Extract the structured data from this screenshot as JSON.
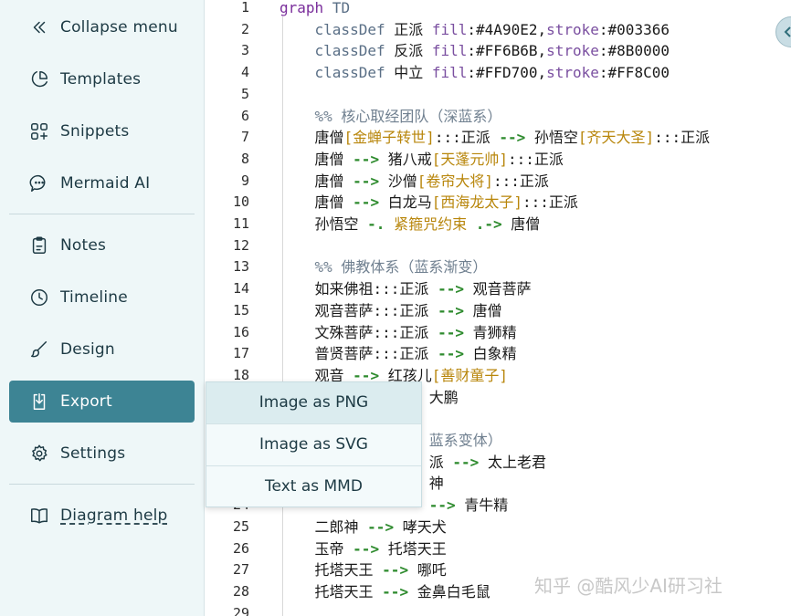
{
  "sidebar": {
    "collapse_label": "Collapse menu",
    "templates_label": "Templates",
    "snippets_label": "Snippets",
    "mermaid_ai_label": "Mermaid AI",
    "notes_label": "Notes",
    "timeline_label": "Timeline",
    "design_label": "Design",
    "export_label": "Export",
    "settings_label": "Settings",
    "help_label": "Diagram help"
  },
  "export_menu": {
    "png_label": "Image as PNG",
    "svg_label": "Image as SVG",
    "mmd_label": "Text as MMD"
  },
  "editor": {
    "line_numbers": [
      "1",
      "2",
      "3",
      "4",
      "5",
      "6",
      "7",
      "8",
      "9",
      "10",
      "11",
      "12",
      "13",
      "14",
      "15",
      "16",
      "17",
      "18",
      "19",
      "20",
      "21",
      "22",
      "23",
      "24",
      "25",
      "26",
      "27",
      "28",
      "29"
    ],
    "lines": [
      [
        {
          "t": "graph",
          "c": "kw"
        },
        {
          "t": " TD",
          "c": "kw2"
        }
      ],
      [
        {
          "t": "    classDef",
          "c": "kw2"
        },
        {
          "t": " 正派 ",
          "c": ""
        },
        {
          "t": "fill",
          "c": "fill"
        },
        {
          "t": ":#4A90E2,",
          "c": ""
        },
        {
          "t": "stroke",
          "c": "fill"
        },
        {
          "t": ":#003366",
          "c": ""
        }
      ],
      [
        {
          "t": "    classDef",
          "c": "kw2"
        },
        {
          "t": " 反派 ",
          "c": ""
        },
        {
          "t": "fill",
          "c": "fill"
        },
        {
          "t": ":#FF6B6B,",
          "c": ""
        },
        {
          "t": "stroke",
          "c": "fill"
        },
        {
          "t": ":#8B0000",
          "c": ""
        }
      ],
      [
        {
          "t": "    classDef",
          "c": "kw2"
        },
        {
          "t": " 中立 ",
          "c": ""
        },
        {
          "t": "fill",
          "c": "fill"
        },
        {
          "t": ":#FFD700,",
          "c": ""
        },
        {
          "t": "stroke",
          "c": "fill"
        },
        {
          "t": ":#FF8C00",
          "c": ""
        }
      ],
      [],
      [
        {
          "t": "    %% 核心取经团队（深蓝系）",
          "c": "cm"
        }
      ],
      [
        {
          "t": "    唐僧",
          "c": ""
        },
        {
          "t": "[金蝉子转世]",
          "c": "lbl"
        },
        {
          "t": ":::正派 ",
          "c": ""
        },
        {
          "t": "-->",
          "c": "arrow"
        },
        {
          "t": " 孙悟空",
          "c": ""
        },
        {
          "t": "[齐天大圣]",
          "c": "lbl"
        },
        {
          "t": ":::正派",
          "c": ""
        }
      ],
      [
        {
          "t": "    唐僧 ",
          "c": ""
        },
        {
          "t": "-->",
          "c": "arrow"
        },
        {
          "t": " 猪八戒",
          "c": ""
        },
        {
          "t": "[天蓬元帅]",
          "c": "lbl"
        },
        {
          "t": ":::正派",
          "c": ""
        }
      ],
      [
        {
          "t": "    唐僧 ",
          "c": ""
        },
        {
          "t": "-->",
          "c": "arrow"
        },
        {
          "t": " 沙僧",
          "c": ""
        },
        {
          "t": "[卷帘大将]",
          "c": "lbl"
        },
        {
          "t": ":::正派",
          "c": ""
        }
      ],
      [
        {
          "t": "    唐僧 ",
          "c": ""
        },
        {
          "t": "-->",
          "c": "arrow"
        },
        {
          "t": " 白龙马",
          "c": ""
        },
        {
          "t": "[西海龙太子]",
          "c": "lbl"
        },
        {
          "t": ":::正派",
          "c": ""
        }
      ],
      [
        {
          "t": "    孙悟空 ",
          "c": ""
        },
        {
          "t": "-.",
          "c": "arrow"
        },
        {
          "t": " 紧箍咒约束 ",
          "c": "lbl"
        },
        {
          "t": ".->",
          "c": "arrow"
        },
        {
          "t": " 唐僧",
          "c": ""
        }
      ],
      [],
      [
        {
          "t": "    %% 佛教体系（蓝系渐变）",
          "c": "cm"
        }
      ],
      [
        {
          "t": "    如来佛祖:::正派 ",
          "c": ""
        },
        {
          "t": "-->",
          "c": "arrow"
        },
        {
          "t": " 观音菩萨",
          "c": ""
        }
      ],
      [
        {
          "t": "    观音菩萨:::正派 ",
          "c": ""
        },
        {
          "t": "-->",
          "c": "arrow"
        },
        {
          "t": " 唐僧",
          "c": ""
        }
      ],
      [
        {
          "t": "    文殊菩萨:::正派 ",
          "c": ""
        },
        {
          "t": "-->",
          "c": "arrow"
        },
        {
          "t": " 青狮精",
          "c": ""
        }
      ],
      [
        {
          "t": "    普贤菩萨:::正派 ",
          "c": ""
        },
        {
          "t": "-->",
          "c": "arrow"
        },
        {
          "t": " 白象精",
          "c": ""
        }
      ],
      [
        {
          "t": "    观音 ",
          "c": ""
        },
        {
          "t": "-->",
          "c": "arrow"
        },
        {
          "t": " 红孩儿",
          "c": ""
        },
        {
          "t": "[善财童子]",
          "c": "lbl"
        }
      ],
      [
        {
          "t": "                 大鹏",
          "c": ""
        }
      ],
      [],
      [
        {
          "t": "                 蓝系变体）",
          "c": "cm"
        }
      ],
      [
        {
          "t": "                 派 ",
          "c": ""
        },
        {
          "t": "-->",
          "c": "arrow"
        },
        {
          "t": " 太上老君",
          "c": ""
        }
      ],
      [
        {
          "t": "                 神",
          "c": ""
        }
      ],
      [
        {
          "t": "                 ",
          "c": ""
        },
        {
          "t": "-->",
          "c": "arrow"
        },
        {
          "t": " 青牛精",
          "c": ""
        }
      ],
      [
        {
          "t": "    二郎神 ",
          "c": ""
        },
        {
          "t": "-->",
          "c": "arrow"
        },
        {
          "t": " 哮天犬",
          "c": ""
        }
      ],
      [
        {
          "t": "    玉帝 ",
          "c": ""
        },
        {
          "t": "-->",
          "c": "arrow"
        },
        {
          "t": " 托塔天王",
          "c": ""
        }
      ],
      [
        {
          "t": "    托塔天王 ",
          "c": ""
        },
        {
          "t": "-->",
          "c": "arrow"
        },
        {
          "t": " 哪吒",
          "c": ""
        }
      ],
      [
        {
          "t": "    托塔天王 ",
          "c": ""
        },
        {
          "t": "-->",
          "c": "arrow"
        },
        {
          "t": " 金鼻白毛鼠",
          "c": ""
        }
      ],
      []
    ]
  },
  "watermark": "知乎 @酷风少AI研习社",
  "colors": {
    "accent": "#3d8494",
    "sidebar_bg": "#eef7f8"
  }
}
